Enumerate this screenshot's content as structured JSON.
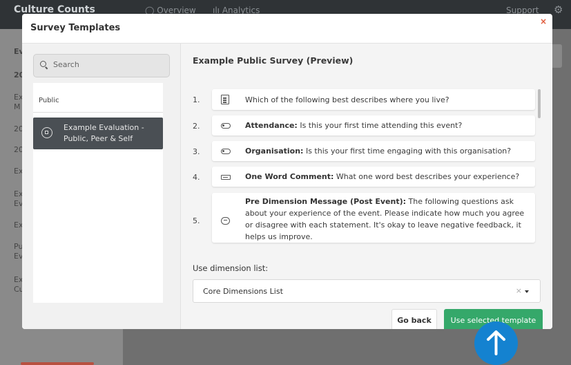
{
  "app": {
    "brand": "Culture Counts",
    "nav": {
      "overview": "Overview",
      "analytics": "Analytics",
      "support": "Support"
    },
    "sidebar_items": [
      "Ev",
      "20",
      "Ex\nM",
      "20",
      "20",
      "Ex",
      "Ex\nEv",
      "Ex",
      "Pu\nEv",
      "Ex\nCu"
    ]
  },
  "modal": {
    "title": "Survey Templates",
    "close": "×",
    "search": {
      "placeholder": "Search",
      "value": ""
    },
    "group_label": "Public",
    "selected_template": "Example Evaluation - Public, Peer & Self",
    "preview_title": "Example Public Survey (Preview)",
    "questions": [
      {
        "num": "1.",
        "icon": "document-icon",
        "label": "",
        "text": "Which of the following best describes where you live?"
      },
      {
        "num": "2.",
        "icon": "toggle-icon",
        "label": "Attendance:",
        "text": " Is this your first time attending this event?"
      },
      {
        "num": "3.",
        "icon": "toggle-icon",
        "label": "Organisation:",
        "text": " Is this your first time engaging with this organisation?"
      },
      {
        "num": "4.",
        "icon": "text-field-icon",
        "label": "One Word Comment:",
        "text": " What one word best describes your experience?"
      },
      {
        "num": "5.",
        "icon": "message-icon",
        "label": "Pre Dimension Message (Post Event):",
        "text": " The following questions ask about your experience of the event. Please indicate how much you agree or disagree with each statement. It's okay to leave negative feedback, it helps us improve."
      }
    ],
    "dimension_label": "Use dimension list:",
    "dimension_value": "Core Dimensions List",
    "dimension_clear": "×",
    "buttons": {
      "back": "Go back",
      "use": "Use selected template"
    }
  },
  "colors": {
    "accent_green": "#35a86a",
    "close_red": "#e05a3a",
    "arrow_blue": "#1482d0",
    "selected_item": "#4a4f54"
  }
}
